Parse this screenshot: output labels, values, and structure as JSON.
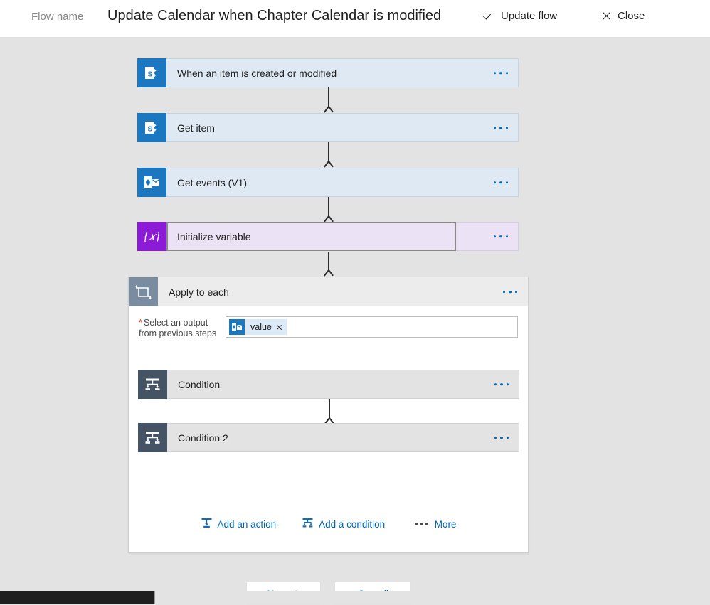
{
  "header": {
    "flow_name_label": "Flow name",
    "flow_title": "Update Calendar when Chapter Calendar is modified",
    "update_flow_label": "Update flow",
    "close_label": "Close"
  },
  "flow": {
    "steps": [
      {
        "title": "When an item is created or modified",
        "icon": "sharepoint-icon",
        "kind": "blue"
      },
      {
        "title": "Get item",
        "icon": "sharepoint-icon",
        "kind": "blue"
      },
      {
        "title": "Get events (V1)",
        "icon": "outlook-icon",
        "kind": "blue"
      },
      {
        "title": "Initialize variable",
        "icon": "variable-icon",
        "kind": "purple"
      }
    ],
    "loop": {
      "title": "Apply to each",
      "icon": "loop-icon",
      "select_label_line1": "Select an output",
      "select_label_line2": "from previous steps",
      "required_marker": "*",
      "token": {
        "label": "value",
        "icon": "outlook-icon"
      },
      "children": [
        {
          "title": "Condition",
          "icon": "condition-icon",
          "kind": "gray"
        },
        {
          "title": "Condition 2",
          "icon": "condition-icon",
          "kind": "gray"
        }
      ],
      "actions": {
        "add_action": "Add an action",
        "add_condition": "Add a condition",
        "more": "More"
      }
    }
  },
  "footer": {
    "new_step": "+ New step",
    "save_flow": "Save flow"
  },
  "colors": {
    "canvas": "#e3e3e3",
    "card_blue": "#dfe9f4",
    "card_purple": "#ece2f5",
    "card_gray": "#e3e3e3",
    "accent_link": "#0065b3",
    "sharepoint": "#1b78c0",
    "outlook": "#1b78c0",
    "variable": "#8c1bd8",
    "loop": "#7a8da0",
    "condition": "#455464",
    "required": "#d93025"
  }
}
